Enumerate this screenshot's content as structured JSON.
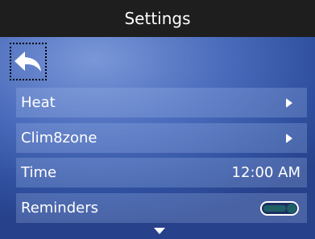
{
  "header": {
    "title": "Settings"
  },
  "menu": {
    "items": [
      {
        "label": "Heat",
        "control": "chevron-right-icon"
      },
      {
        "label": "Clim8zone",
        "control": "chevron-right-icon"
      },
      {
        "label": "Time",
        "value": "12:00 AM"
      },
      {
        "label": "Reminders",
        "control": "toggle",
        "state": "on"
      }
    ]
  },
  "icons": {
    "back": "back-arrow-icon",
    "more": "chevron-down-icon"
  },
  "colors": {
    "titlebar": "#1e1e1e",
    "accent_toggle": "#1f5f66",
    "text": "#ffffff"
  }
}
